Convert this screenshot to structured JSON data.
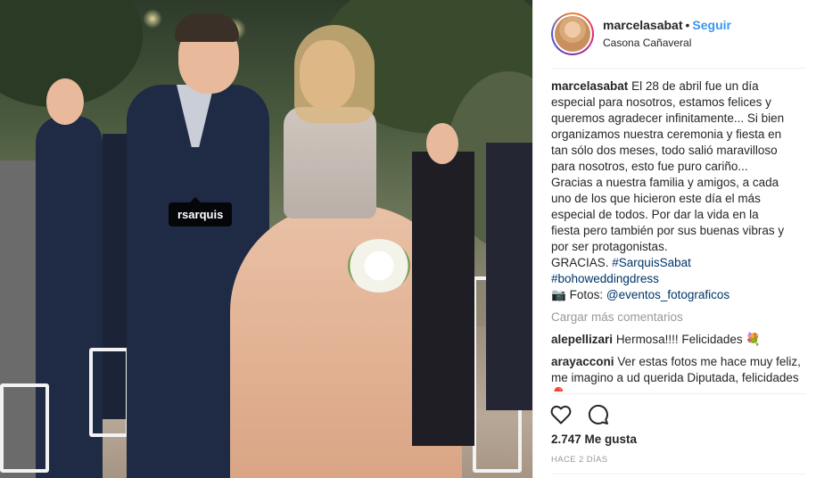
{
  "photo": {
    "tag_label": "rsarquis"
  },
  "header": {
    "username": "marcelasabat",
    "separator": "•",
    "follow_label": "Seguir",
    "location": "Casona Cañaveral"
  },
  "caption": {
    "username": "marcelasabat",
    "text_lines": [
      "El 28 de abril fue un día",
      "especial para nosotros, estamos felices y",
      "queremos agradecer infinitamente... Si bien",
      "organizamos nuestra ceremonia y fiesta en",
      "tan sólo dos meses, todo salió maravilloso",
      "para nosotros, esto fue puro cariño...",
      "Gracias a nuestra familia y amigos, a cada",
      "uno de los que hicieron este día el más",
      "especial de todos. Por dar la vida en la",
      "fiesta pero también por sus buenas vibras y",
      "por ser protagonistas."
    ],
    "gracias": "GRACIAS.",
    "hashtag1": "#SarquisSabat",
    "hashtag2": "#bohoweddingdress",
    "camera_emoji": "📷",
    "fotos_label": "Fotos:",
    "mention": "@eventos_fotograficos"
  },
  "load_more_label": "Cargar más comentarios",
  "comments": [
    {
      "username": "alepellizari",
      "text": "Hermosa!!!! Felicidades",
      "emoji": "💐"
    },
    {
      "username": "arayacconi",
      "text": "Ver estas fotos me hace muy feliz, me imagino a ud querida Diputada, felicidades",
      "emoji": "🎈"
    }
  ],
  "actions": {
    "like_icon": "heart-icon",
    "comment_icon": "comment-icon"
  },
  "likes_text": "2.747 Me gusta",
  "timestamp": "HACE 2 DÍAS",
  "colors": {
    "link": "#003569",
    "follow": "#3897f0",
    "muted": "#999999",
    "text": "#262626"
  }
}
